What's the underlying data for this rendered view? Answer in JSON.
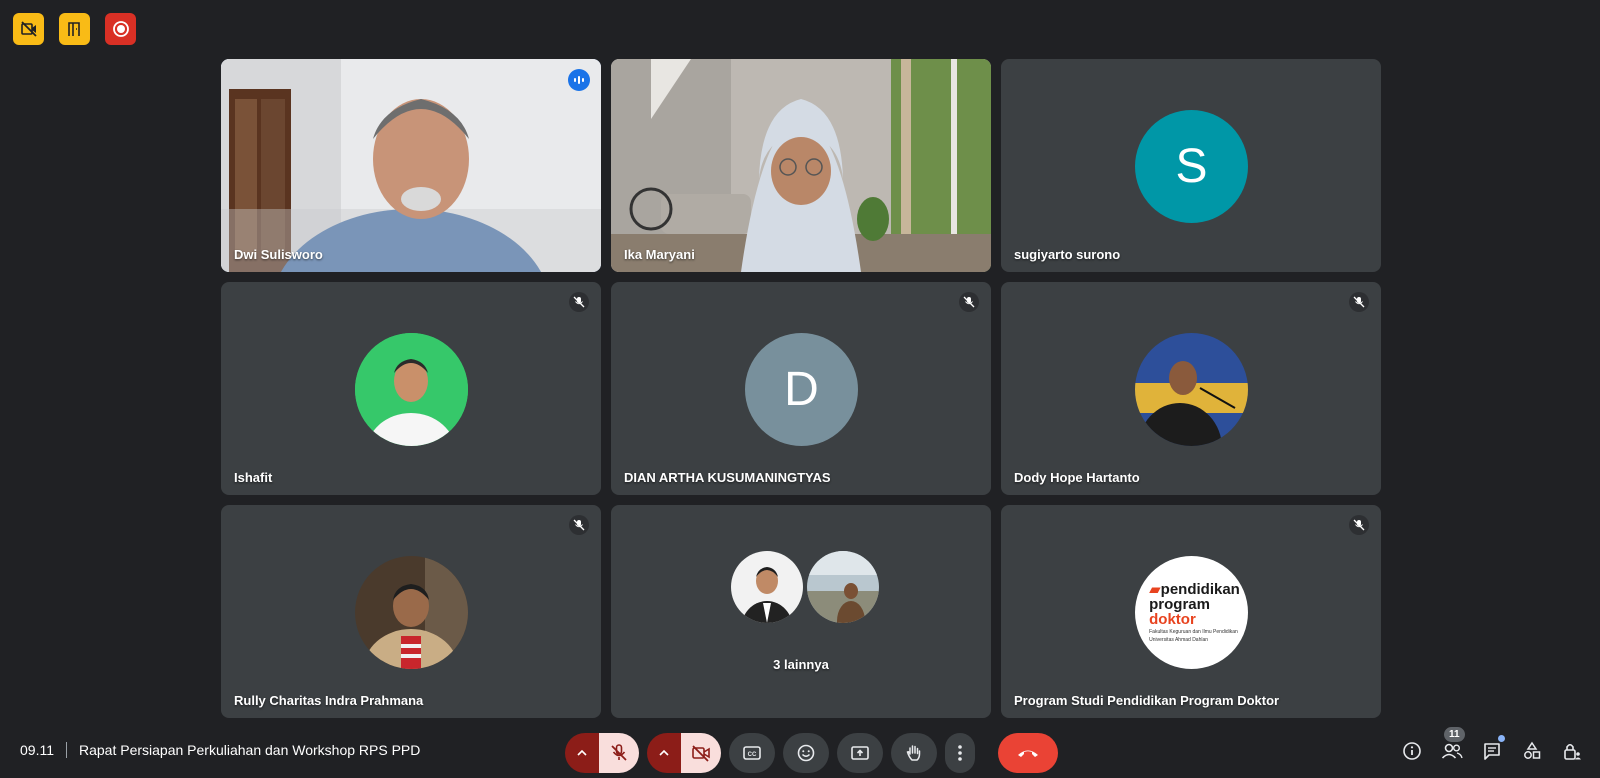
{
  "badges": [
    {
      "icon": "no-video-recording-icon",
      "color": "#f9bb16"
    },
    {
      "icon": "door-exit-icon",
      "color": "#f9bb16"
    },
    {
      "icon": "recording-icon",
      "color": "#d93025"
    }
  ],
  "participants": [
    {
      "name": "Dwi Sulisworo",
      "type": "video",
      "speaking": true
    },
    {
      "name": "Ika Maryani",
      "type": "video"
    },
    {
      "name": "sugiyarto surono",
      "type": "letter",
      "letter": "S",
      "color": "#0097a7"
    },
    {
      "name": "Ishafit",
      "type": "photo",
      "muted": true
    },
    {
      "name": "DIAN ARTHA KUSUMANINGTYAS",
      "type": "letter",
      "letter": "D",
      "color": "#78909c",
      "muted": true
    },
    {
      "name": "Dody Hope Hartanto",
      "type": "photo",
      "muted": true
    },
    {
      "name": "Rully Charitas Indra Prahmana",
      "type": "photo",
      "muted": true
    },
    {
      "name": "3 lainnya",
      "type": "group"
    },
    {
      "name": "Program Studi Pendidikan Program Doktor",
      "type": "logo",
      "muted": true,
      "logo": {
        "line1": "pendidikan",
        "line2": "program",
        "line3": "doktor",
        "sub1": "Fakultas Keguruan dan Ilmu Pendidikan",
        "sub2": "Universitas Ahmad Dahlan"
      }
    }
  ],
  "meeting": {
    "time": "09.11",
    "title": "Rapat Persiapan Perkuliahan dan Workshop RPS PPD"
  },
  "people_count": "11",
  "colors": {
    "background": "#202124",
    "tile": "#3c4043",
    "active_outline": "#8ab4f8",
    "end_call": "#ea4335"
  }
}
